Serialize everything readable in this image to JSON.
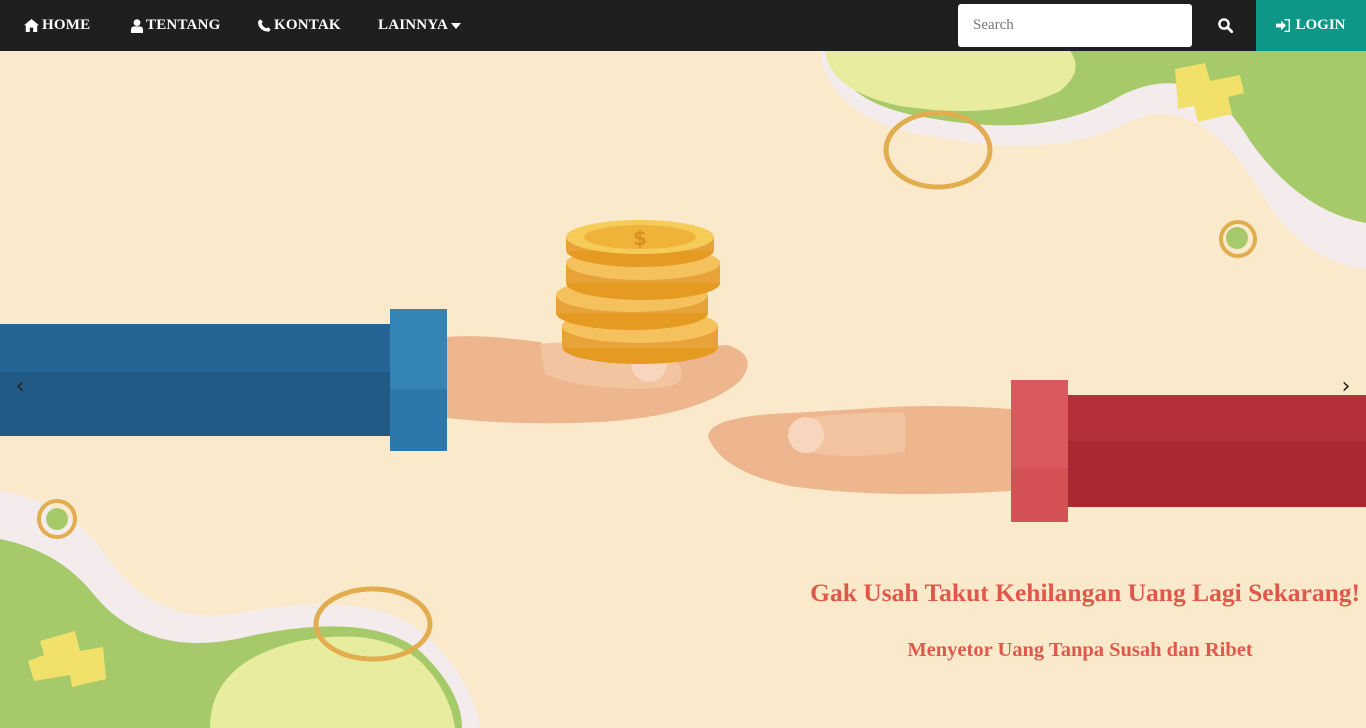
{
  "nav": {
    "items": [
      {
        "label": "HOME",
        "icon": "home-icon"
      },
      {
        "label": "TENTANG",
        "icon": "user-icon"
      },
      {
        "label": "KONTAK",
        "icon": "phone-icon"
      },
      {
        "label": "LAINNYA",
        "icon": "caret-down-icon"
      }
    ],
    "search_placeholder": "Search",
    "search_value": "",
    "login_label": "LOGIN"
  },
  "hero": {
    "headline": "Gak Usah Takut Kehilangan Uang Lagi Sekarang!",
    "subheadline": "Menyetor Uang Tanpa Susah dan Ribet",
    "prev_glyph": "‹",
    "next_glyph": "›"
  },
  "colors": {
    "navbar": "#1f1f1f",
    "login": "#0e9686",
    "background": "#faeacb",
    "headline": "#e0584a",
    "blob_green": "#a6c96a",
    "blob_lime": "#e8ec9e",
    "sleeve_blue": "#215a85",
    "sleeve_red": "#b02d33",
    "coin_gold": "#f2b52f"
  }
}
